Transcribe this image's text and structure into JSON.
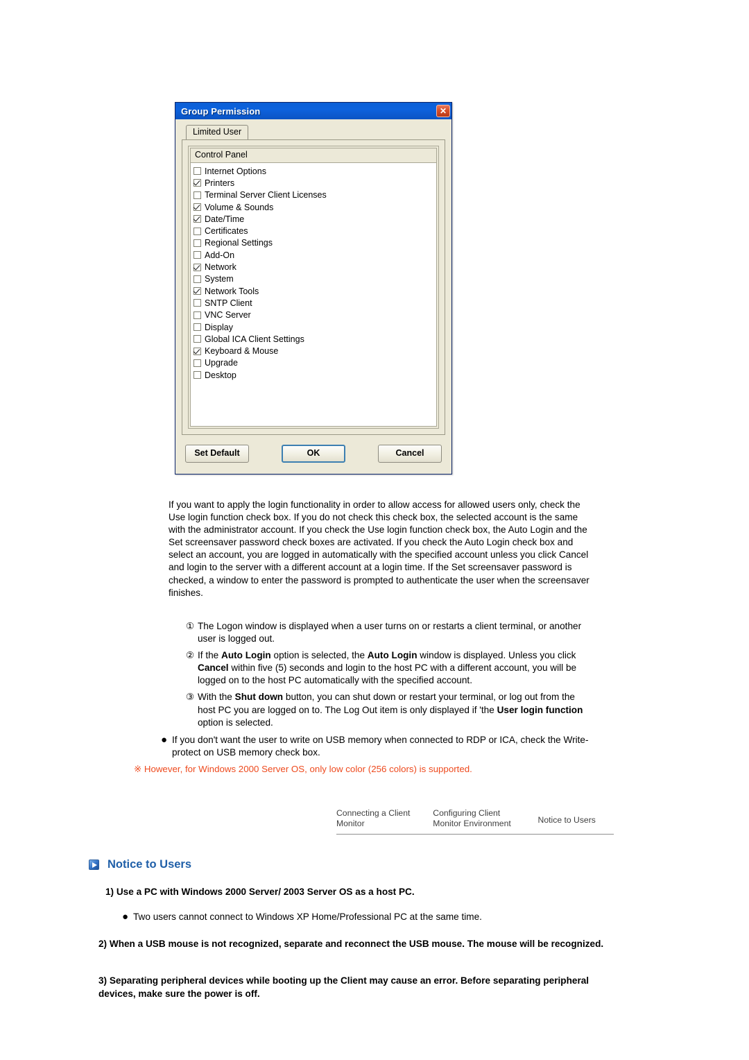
{
  "dialog": {
    "title": "Group Permission",
    "close_label": "✕",
    "tab": "Limited User",
    "group_header": "Control Panel",
    "items": [
      {
        "label": "Internet Options",
        "checked": false
      },
      {
        "label": "Printers",
        "checked": true
      },
      {
        "label": "Terminal Server Client Licenses",
        "checked": false
      },
      {
        "label": "Volume & Sounds",
        "checked": true
      },
      {
        "label": "Date/Time",
        "checked": true
      },
      {
        "label": "Certificates",
        "checked": false
      },
      {
        "label": "Regional Settings",
        "checked": false
      },
      {
        "label": "Add-On",
        "checked": false
      },
      {
        "label": "Network",
        "checked": true
      },
      {
        "label": "System",
        "checked": false
      },
      {
        "label": "Network Tools",
        "checked": true
      },
      {
        "label": "SNTP Client",
        "checked": false
      },
      {
        "label": "VNC Server",
        "checked": false
      },
      {
        "label": "Display",
        "checked": false
      },
      {
        "label": "Global ICA Client Settings",
        "checked": false
      },
      {
        "label": "Keyboard & Mouse",
        "checked": true
      },
      {
        "label": "Upgrade",
        "checked": false
      },
      {
        "label": "Desktop",
        "checked": false
      }
    ],
    "buttons": {
      "set_default": "Set Default",
      "ok": "OK",
      "cancel": "Cancel"
    }
  },
  "body": {
    "paragraph": "If you want to apply the login functionality in order to allow access for allowed users only, check the Use login function check box. If you do not check this check box, the selected account is the same with the administrator account. If you check the Use login function check box, the Auto Login and the Set screensaver password check boxes are activated. If you check the Auto Login check box and select an account, you are logged in automatically with the specified account unless you click Cancel and login to the server with a different account at a login time. If the Set screensaver password is checked, a window to enter the password is prompted to authenticate the user when the screensaver finishes.",
    "numbered": [
      {
        "marker": "①",
        "text": "The Logon window is displayed when a user turns on or restarts a client terminal, or another user is logged out."
      },
      {
        "marker": "②",
        "text": "If the Auto Login option is selected, the Auto Login window is displayed. Unless you click Cancel within five (5) seconds and login to the host PC with a different account, you will be logged on to the host PC automatically with the specified account.",
        "bold_terms": [
          "Auto Login",
          "Cancel"
        ]
      },
      {
        "marker": "③",
        "text": "With the Shut down button, you can shut down or restart your terminal, or log out from the host PC you are logged on to. The Log Out item is only displayed if 'the User login function option is selected.",
        "bold_terms": [
          "Shut down",
          "User login function"
        ]
      }
    ],
    "bullet": {
      "marker": "●",
      "text": "If you don't want the user to write on USB memory when connected to RDP or ICA, check the Write-protect on USB memory check box."
    },
    "red_note": "※  However, for Windows 2000 Server OS, only low color (256 colors) is supported.",
    "red_note_color": "#ee4a1e"
  },
  "nav_footer": {
    "col1": "Connecting a Client\nMonitor",
    "col2": "Configuring Client\nMonitor Environment",
    "col3": "Notice to Users"
  },
  "notice": {
    "title": "Notice to Users",
    "title_color": "#1f5fa8",
    "item1": "1) Use a PC with Windows 2000 Server/ 2003 Server OS as a host PC.",
    "bullet_marker": "●",
    "bullet1": "Two users cannot connect to Windows XP Home/Professional PC at the same time.",
    "item2": "2) When a USB mouse is not recognized, separate and reconnect the USB mouse. The mouse will be recognized.",
    "item3": "3) Separating peripheral devices while booting up the Client may cause an error. Before separating peripheral devices, make sure the power is off."
  }
}
